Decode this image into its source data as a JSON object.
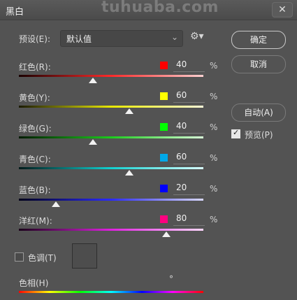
{
  "window": {
    "title": "黑白",
    "watermark": "tuhuaba.com",
    "close_label": "✕"
  },
  "preset": {
    "label": "预设(E):",
    "value": "默认值",
    "caret": "⌄"
  },
  "buttons": {
    "ok": "确定",
    "cancel": "取消",
    "auto": "自动(A)"
  },
  "preview": {
    "label": "预览(P)",
    "checked": true
  },
  "channels": [
    {
      "label": "红色(R):",
      "value": "40",
      "unit": "%",
      "color": "#ff0000",
      "level": 0.4
    },
    {
      "label": "黄色(Y):",
      "value": "60",
      "unit": "%",
      "color": "#ffff00",
      "level": 0.6
    },
    {
      "label": "绿色(G):",
      "value": "40",
      "unit": "%",
      "color": "#00ff00",
      "level": 0.4
    },
    {
      "label": "青色(C):",
      "value": "60",
      "unit": "%",
      "color": "#00a8e8",
      "level": 0.6
    },
    {
      "label": "蓝色(B):",
      "value": "20",
      "unit": "%",
      "color": "#0000ff",
      "level": 0.2
    },
    {
      "label": "洋红(M):",
      "value": "80",
      "unit": "%",
      "color": "#ff0080",
      "level": 0.8
    }
  ],
  "tint": {
    "label": "色调(T)",
    "checked": false
  },
  "hue": {
    "label": "色相(H)",
    "degree": "°"
  },
  "icons": {
    "gear": "gear-icon",
    "close": "close-icon",
    "check": "checkbox-icon"
  }
}
